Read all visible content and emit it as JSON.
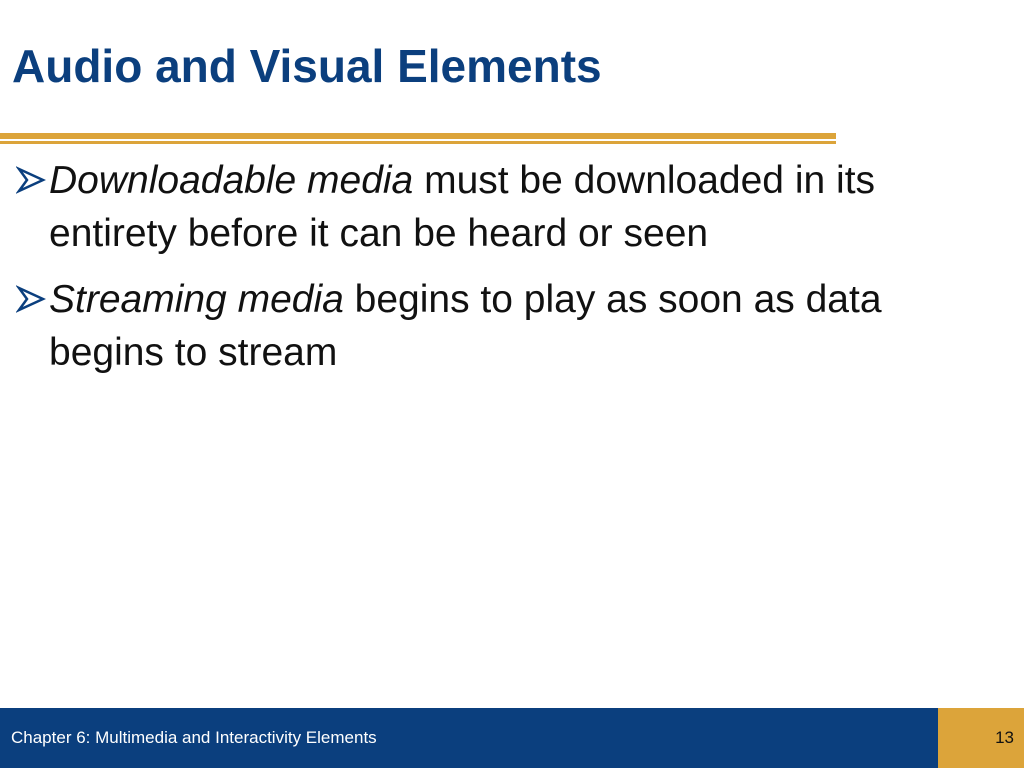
{
  "slide": {
    "title": "Audio and Visual Elements",
    "bullets": [
      {
        "term": "Downloadable media",
        "text": " must be downloaded in its entirety before it can be heard or seen"
      },
      {
        "term": "Streaming media",
        "text": " begins to play as soon as data begins to stream"
      }
    ]
  },
  "footer": {
    "chapter": "Chapter 6: Multimedia and Interactivity Elements",
    "page_number": "13"
  },
  "icons": {
    "bullet": "arrow-bullet-icon"
  },
  "colors": {
    "title_blue": "#0b3f7e",
    "accent_gold": "#dca43a",
    "footer_blue": "#0b3f7e"
  }
}
